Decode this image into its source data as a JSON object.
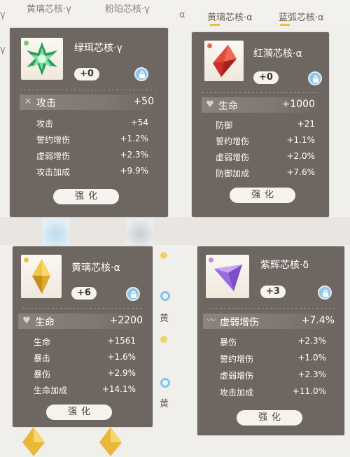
{
  "background": {
    "top_labels": [
      "黄璃芯核·γ",
      "粉珀芯核·γ",
      "黄璃芯核·α",
      "蓝弧芯核·α"
    ],
    "side_label_1": "黄",
    "side_label_2": "黄",
    "side_label_3": "·",
    "side_label_4": "α",
    "side_label_5": "γ",
    "side_label_6": "γ"
  },
  "cards": [
    {
      "name": "绿珥芯核·γ",
      "level": "+0",
      "main": {
        "label": "攻击",
        "value": "+50",
        "icon": "crossed-swords-icon"
      },
      "subs": [
        {
          "label": "攻击",
          "value": "+54"
        },
        {
          "label": "誓约增伤",
          "value": "+1.2%"
        },
        {
          "label": "虚弱增伤",
          "value": "+2.3%"
        },
        {
          "label": "攻击加成",
          "value": "+9.9%"
        }
      ],
      "upgrade_label": "强化",
      "gem_color": "#3fb56a",
      "gem_icon": "green-star-gem-icon"
    },
    {
      "name": "红漪芯核·α",
      "level": "+0",
      "main": {
        "label": "生命",
        "value": "+1000",
        "icon": "heart-icon"
      },
      "subs": [
        {
          "label": "防御",
          "value": "+21"
        },
        {
          "label": "誓约增伤",
          "value": "+1.1%"
        },
        {
          "label": "虚弱增伤",
          "value": "+2.0%"
        },
        {
          "label": "防御加成",
          "value": "+7.6%"
        }
      ],
      "upgrade_label": "强化",
      "gem_color": "#e0453a",
      "gem_icon": "red-diamond-gem-icon"
    },
    {
      "name": "黄璃芯核·α",
      "level": "+6",
      "main": {
        "label": "生命",
        "value": "+2200",
        "icon": "heart-icon"
      },
      "subs": [
        {
          "label": "生命",
          "value": "+1561"
        },
        {
          "label": "暴击",
          "value": "+1.6%"
        },
        {
          "label": "暴伤",
          "value": "+2.9%"
        },
        {
          "label": "生命加成",
          "value": "+14.1%"
        }
      ],
      "upgrade_label": "强化",
      "gem_color": "#f0c23a",
      "gem_icon": "yellow-diamond-gem-icon"
    },
    {
      "name": "紫辉芯核·δ",
      "level": "+3",
      "main": {
        "label": "虚弱增伤",
        "value": "+7.4%",
        "icon": "wave-icon"
      },
      "subs": [
        {
          "label": "暴伤",
          "value": "+2.3%"
        },
        {
          "label": "誓约增伤",
          "value": "+1.0%"
        },
        {
          "label": "虚弱增伤",
          "value": "+2.3%"
        },
        {
          "label": "攻击加成",
          "value": "+11.0%"
        }
      ],
      "upgrade_label": "强化",
      "gem_color": "#9a6be0",
      "gem_icon": "purple-prism-gem-icon"
    }
  ],
  "colors": {
    "card_bg": "#6e6661",
    "pill_bg": "#f6f3ef",
    "lock_blue": "#8ec7e8",
    "accent_yellow": "#e8c23a"
  }
}
